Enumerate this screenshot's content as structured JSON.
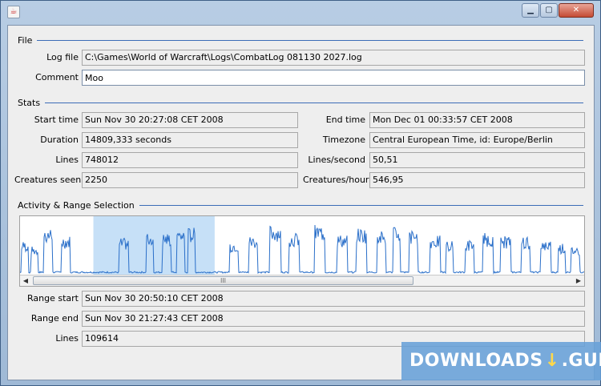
{
  "window": {
    "title": "",
    "icon": "java-icon"
  },
  "file": {
    "section": "File",
    "log_file_label": "Log file",
    "log_file_value": "C:\\Games\\World of Warcraft\\Logs\\CombatLog 081130 2027.log",
    "comment_label": "Comment",
    "comment_value": "Moo"
  },
  "stats": {
    "section": "Stats",
    "start_time_label": "Start time",
    "start_time_value": "Sun Nov 30 20:27:08 CET 2008",
    "end_time_label": "End time",
    "end_time_value": "Mon Dec 01 00:33:57 CET 2008",
    "duration_label": "Duration",
    "duration_value": "14809,333 seconds",
    "timezone_label": "Timezone",
    "timezone_value": "Central European Time, id: Europe/Berlin",
    "lines_label": "Lines",
    "lines_value": "748012",
    "lines_second_label": "Lines/second",
    "lines_second_value": "50,51",
    "creatures_seen_label": "Creatures seen",
    "creatures_seen_value": "2250",
    "creatures_hour_label": "Creatures/hour",
    "creatures_hour_value": "546,95"
  },
  "activity": {
    "section": "Activity & Range Selection",
    "line_color": "#2a6fc9",
    "selection_color": "#c6e0f7",
    "scroll_thumb_grip": "III",
    "selection": {
      "start_fraction": 0.13,
      "end_fraction": 0.345
    }
  },
  "range": {
    "start_label": "Range start",
    "start_value": "Sun Nov 30 20:50:10 CET 2008",
    "end_label": "Range end",
    "end_value": "Sun Nov 30 21:27:43 CET 2008",
    "lines_label": "Lines",
    "lines_value": "109614"
  },
  "watermark": {
    "text_left": "DOWNLOADS",
    "mark": "↓",
    "text_right": ".GURU"
  }
}
